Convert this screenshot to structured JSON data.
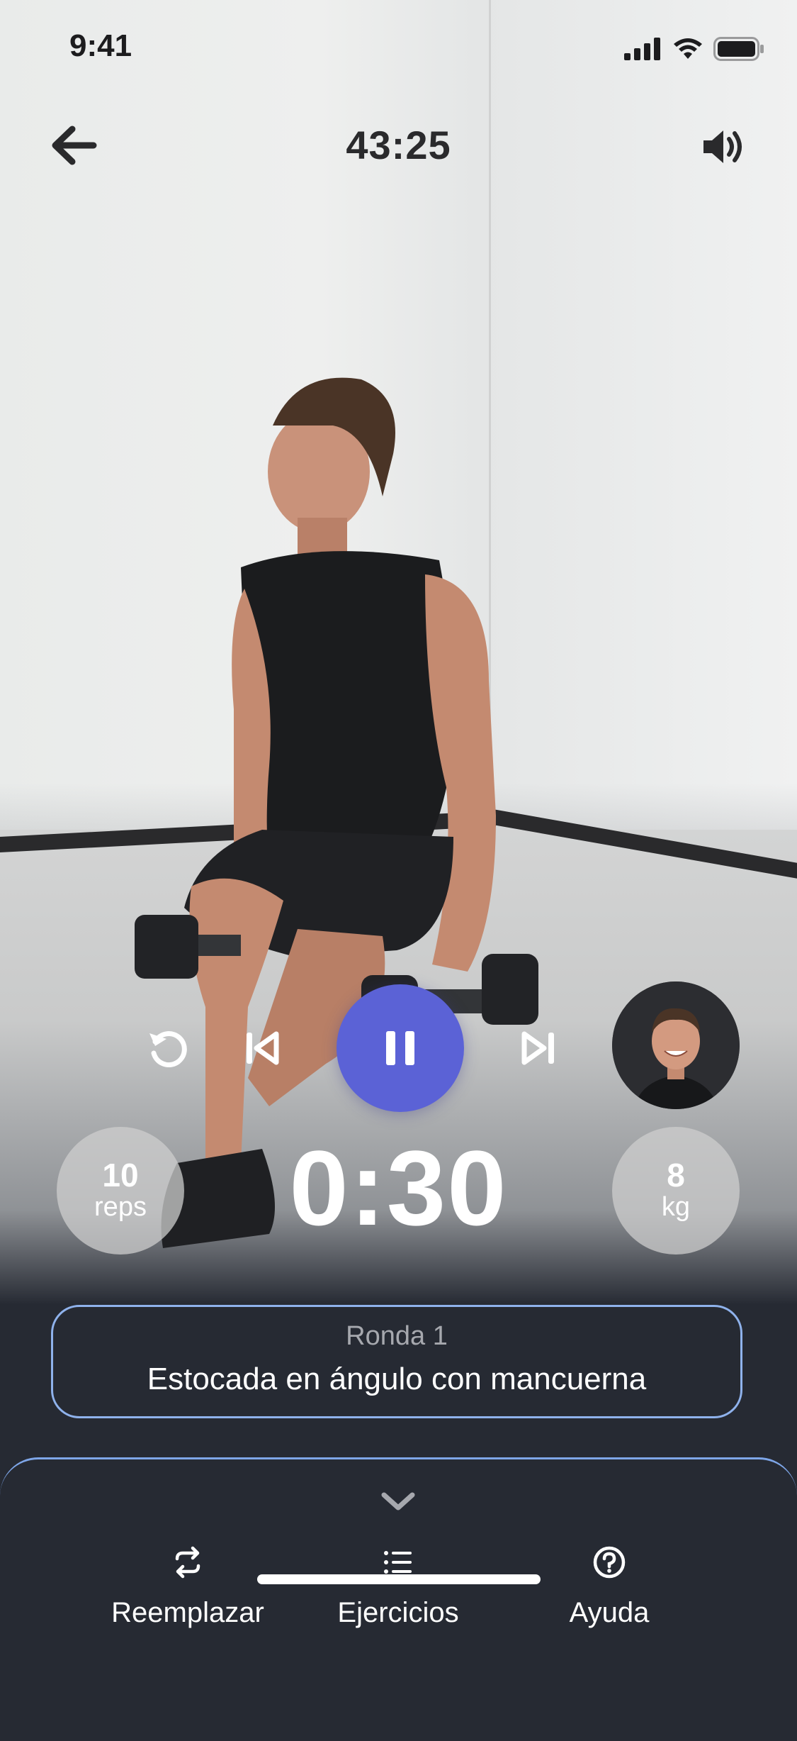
{
  "status_bar": {
    "time": "9:41"
  },
  "nav": {
    "workout_time": "43:25"
  },
  "stats": {
    "reps": {
      "value": "10",
      "unit": "reps"
    },
    "timer": "0:30",
    "weight": {
      "value": "8",
      "unit": "kg"
    }
  },
  "exercise": {
    "round": "Ronda 1",
    "name": "Estocada en ángulo con mancuerna"
  },
  "sheet": {
    "actions": [
      {
        "label": "Reemplazar",
        "icon": "swap-icon"
      },
      {
        "label": "Ejercicios",
        "icon": "list-icon"
      },
      {
        "label": "Ayuda",
        "icon": "help-icon"
      }
    ]
  },
  "colors": {
    "accent": "#5b62d6",
    "card_border": "#8fb2ec",
    "background": "#262a33"
  }
}
